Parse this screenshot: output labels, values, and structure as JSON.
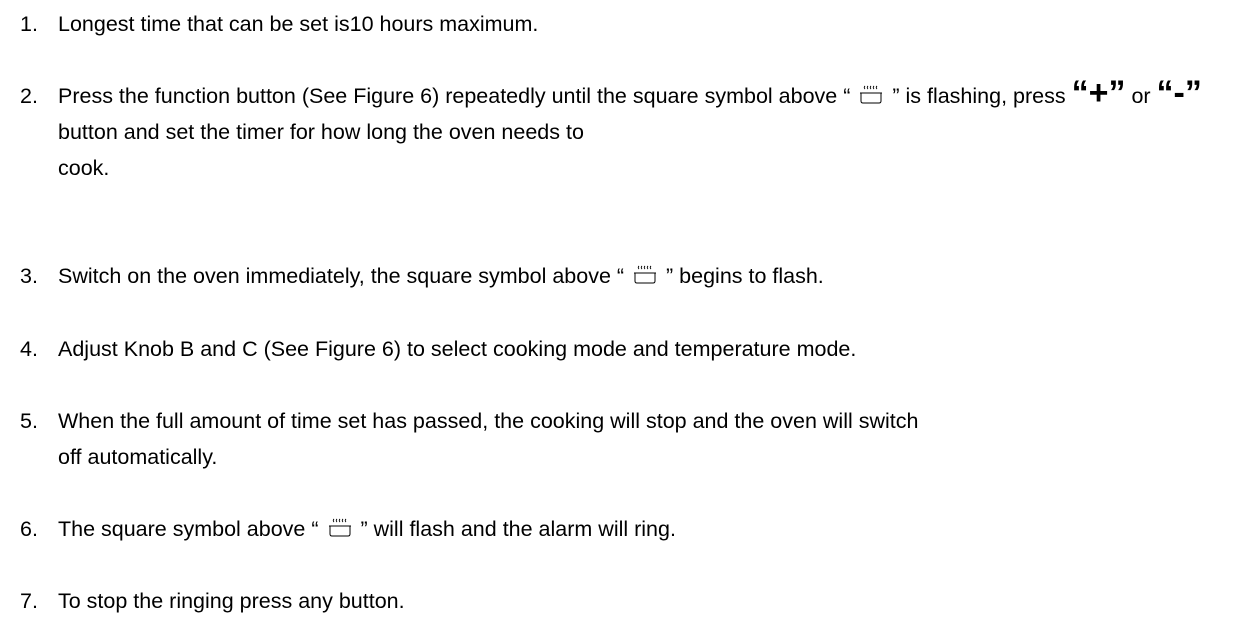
{
  "items": [
    {
      "number": "1.",
      "text": "Longest time that can be set is10 hours maximum."
    },
    {
      "number": "2.",
      "part_a": "Press the function button (See Figure 6) repeatedly until the square symbol above “",
      "part_b": "” is flashing, press",
      "plus_key": "“+”",
      "or_word": "or",
      "minus_key": "“-”",
      "part_c": "button and set the timer for how long the oven needs to",
      "part_d": "cook."
    },
    {
      "number": "3.",
      "part_a": "Switch on the oven immediately, the square symbol above “",
      "part_b": "” begins to flash."
    },
    {
      "number": "4.",
      "text": "Adjust Knob B and C (See Figure 6) to select cooking mode and temperature mode."
    },
    {
      "number": "5.",
      "part_a": "When the full amount of time set has passed, the cooking will stop and the oven will switch",
      "part_b": "off automatically."
    },
    {
      "number": "6.",
      "part_a": "The square symbol above “",
      "part_b": "” will flash and the alarm will ring."
    },
    {
      "number": "7.",
      "text": "To stop the ringing press any button."
    }
  ],
  "icons": {
    "cooking_symbol": "steaming-dish-icon"
  }
}
